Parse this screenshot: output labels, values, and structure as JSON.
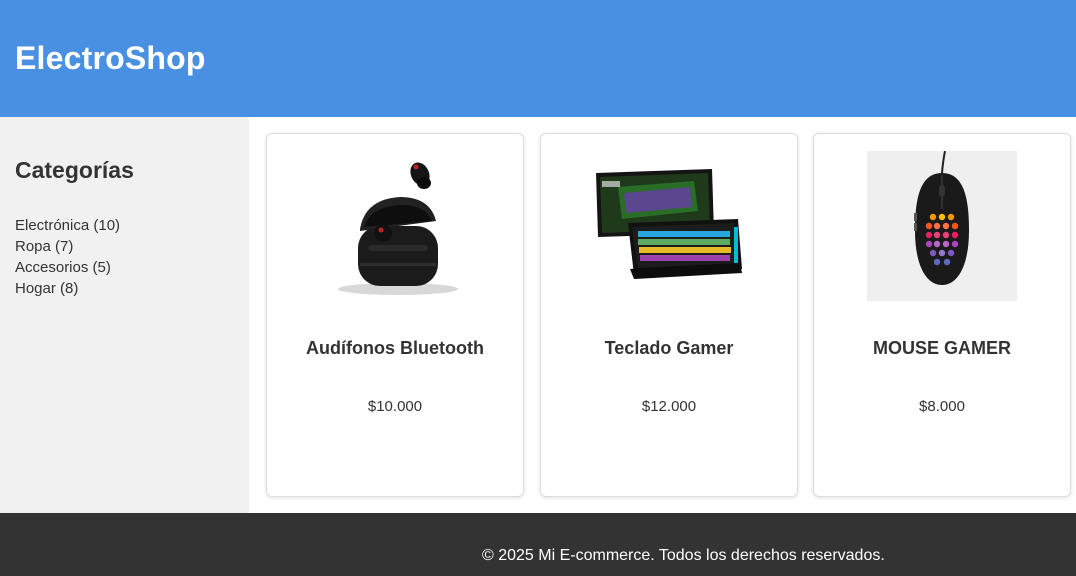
{
  "header": {
    "title": "ElectroShop"
  },
  "sidebar": {
    "title": "Categorías",
    "items": [
      {
        "label": "Electrónica (10)"
      },
      {
        "label": "Ropa (7)"
      },
      {
        "label": "Accesorios (5)"
      },
      {
        "label": "Hogar (8)"
      }
    ]
  },
  "products": [
    {
      "name": "Audífonos Bluetooth",
      "price": "$10.000",
      "icon": "earbuds-image"
    },
    {
      "name": "Teclado Gamer",
      "price": "$12.000",
      "icon": "keyboard-image"
    },
    {
      "name": "MOUSE GAMER",
      "price": "$8.000",
      "icon": "mouse-image"
    }
  ],
  "footer": {
    "text": "© 2025 Mi E-commerce. Todos los derechos reservados."
  },
  "colors": {
    "header_bg": "#4a90e2",
    "sidebar_bg": "#f1f1f1",
    "footer_bg": "#333333"
  }
}
